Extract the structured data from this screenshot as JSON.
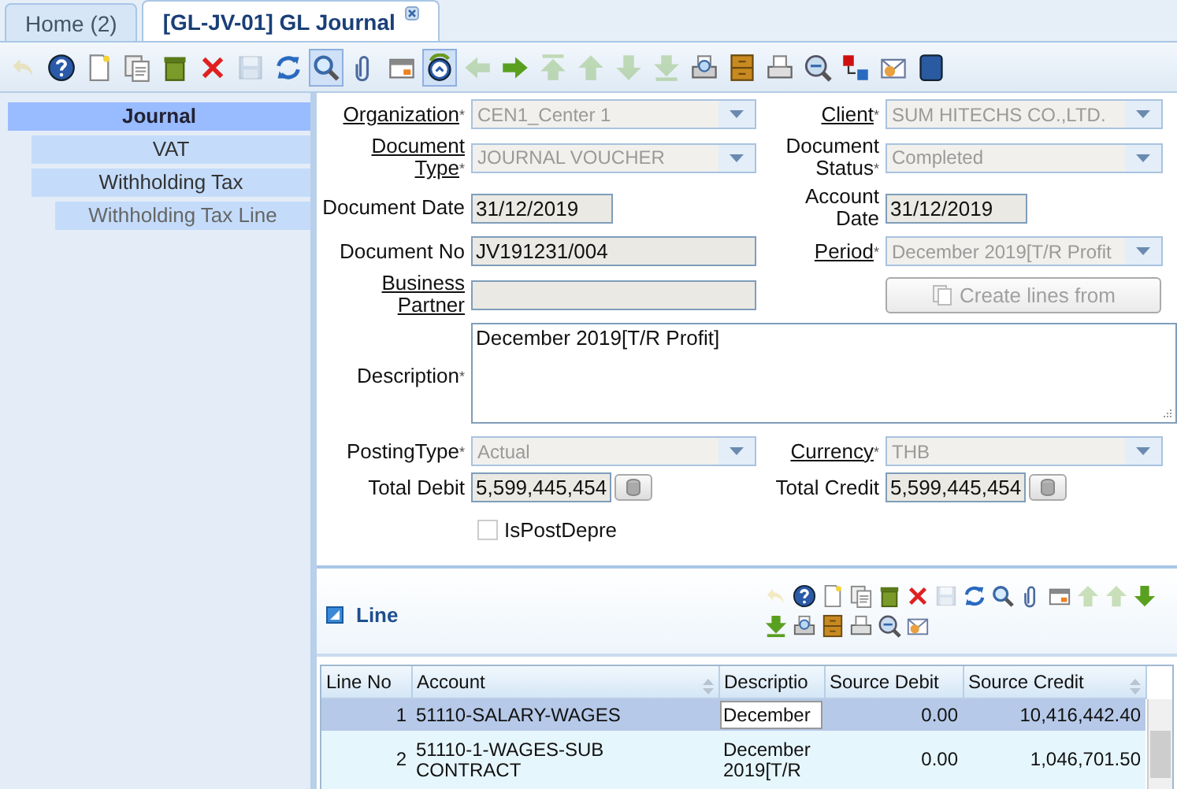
{
  "tabs": [
    {
      "label": "Home (2)",
      "selected": false,
      "closable": false
    },
    {
      "label": "[GL-JV-01] GL Journal",
      "selected": true,
      "closable": true
    }
  ],
  "toolbar": [
    {
      "kind": "undo",
      "disabled": true,
      "pressed": false
    },
    {
      "kind": "help",
      "disabled": false,
      "pressed": false
    },
    {
      "kind": "new",
      "disabled": false,
      "pressed": false
    },
    {
      "kind": "copy",
      "disabled": false,
      "pressed": false
    },
    {
      "kind": "delete",
      "disabled": false,
      "pressed": false
    },
    {
      "kind": "delete_selection",
      "disabled": false,
      "pressed": false
    },
    {
      "kind": "save",
      "disabled": true,
      "pressed": false
    },
    {
      "kind": "refresh",
      "disabled": false,
      "pressed": false
    },
    {
      "kind": "find",
      "disabled": false,
      "pressed": true
    },
    {
      "kind": "attach",
      "disabled": false,
      "pressed": false
    },
    {
      "kind": "grid",
      "disabled": false,
      "pressed": false
    },
    {
      "kind": "history",
      "disabled": false,
      "pressed": true
    },
    {
      "kind": "prev",
      "disabled": true,
      "pressed": false
    },
    {
      "kind": "next",
      "disabled": false,
      "pressed": false
    },
    {
      "kind": "first",
      "disabled": true,
      "pressed": false
    },
    {
      "kind": "up",
      "disabled": true,
      "pressed": false
    },
    {
      "kind": "down",
      "disabled": true,
      "pressed": false
    },
    {
      "kind": "last",
      "disabled": true,
      "pressed": false
    },
    {
      "kind": "print_preview",
      "disabled": false,
      "pressed": false
    },
    {
      "kind": "archive",
      "disabled": false,
      "pressed": false
    },
    {
      "kind": "print",
      "disabled": false,
      "pressed": false
    },
    {
      "kind": "zoom_across",
      "disabled": false,
      "pressed": false
    },
    {
      "kind": "workflow",
      "disabled": false,
      "pressed": false
    },
    {
      "kind": "request",
      "disabled": false,
      "pressed": false
    },
    {
      "kind": "end",
      "disabled": false,
      "pressed": false
    }
  ],
  "sidebar": {
    "items": [
      {
        "label": "Journal",
        "selected": true,
        "disabled": false,
        "children": [
          {
            "label": "VAT",
            "selected": false,
            "disabled": false
          },
          {
            "label": "Withholding Tax",
            "selected": false,
            "disabled": false,
            "children": [
              {
                "label": "Withholding Tax Line",
                "selected": false,
                "disabled": true
              }
            ]
          }
        ]
      }
    ]
  },
  "form": {
    "rows": [
      [
        {
          "label": "Organization",
          "mark": "*",
          "link": true,
          "kind": "select",
          "value": "CEN1_Center 1",
          "disabled": true
        },
        {
          "label": "Client",
          "mark": "*",
          "link": true,
          "kind": "select",
          "value": "SUM HITECHS CO.,LTD.",
          "disabled": true
        }
      ],
      [
        {
          "label": "Document Type",
          "mark": "*",
          "link": true,
          "kind": "select",
          "value": "JOURNAL VOUCHER",
          "disabled": true
        },
        {
          "label": "Document Status",
          "mark": "*",
          "link": false,
          "kind": "select",
          "value": "Completed",
          "disabled": true
        }
      ],
      [
        {
          "label": "Document Date",
          "link": false,
          "kind": "date",
          "value": "31/12/2019",
          "disabled": false
        },
        {
          "label": "Account Date",
          "link": false,
          "kind": "date",
          "value": "31/12/2019",
          "disabled": false
        }
      ],
      [
        {
          "label": "Document No",
          "link": false,
          "kind": "text",
          "value": "JV191231/004",
          "disabled": false
        },
        {
          "label": "Period",
          "mark": "*",
          "link": true,
          "kind": "select",
          "value": "December 2019[T/R Profit",
          "disabled": true
        }
      ],
      [
        {
          "label": "Business Partner",
          "link": true,
          "kind": "text",
          "disabled": false
        },
        {
          "kind": "button",
          "value": "Create lines from",
          "disabled": true
        }
      ],
      [
        {
          "label": "Description",
          "mark": "*",
          "link": false,
          "kind": "textarea",
          "value": "December 2019[T/R Profit]"
        }
      ],
      [
        {
          "label": "PostingType",
          "mark": "*",
          "link": false,
          "kind": "select",
          "value": "Actual",
          "disabled": true
        },
        {
          "label": "Currency",
          "mark": "*",
          "link": true,
          "kind": "select",
          "value": "THB",
          "disabled": true
        }
      ],
      [
        {
          "label": "Total Debit",
          "link": false,
          "kind": "number",
          "value": "5,599,445,454",
          "disabled": false
        },
        {
          "label": "Total Credit",
          "link": false,
          "kind": "number",
          "value": "5,599,445,454",
          "disabled": false
        }
      ],
      [
        {
          "kind": "checkbox",
          "value": "IsPostDepre",
          "checked": false,
          "disabled": true
        }
      ]
    ]
  },
  "line": {
    "title": "Line",
    "expanded": true,
    "toolbar": [
      {
        "kind": "undo",
        "disabled": true
      },
      {
        "kind": "help",
        "disabled": false
      },
      {
        "kind": "new",
        "disabled": false
      },
      {
        "kind": "copy",
        "disabled": false
      },
      {
        "kind": "delete",
        "disabled": false
      },
      {
        "kind": "delete_selection",
        "disabled": false
      },
      {
        "kind": "save",
        "disabled": true
      },
      {
        "kind": "refresh",
        "disabled": false
      },
      {
        "kind": "find",
        "disabled": false
      },
      {
        "kind": "attach",
        "disabled": false
      },
      {
        "kind": "grid",
        "disabled": false
      },
      {
        "kind": "up",
        "disabled": true
      },
      {
        "kind": "up",
        "disabled": true
      },
      {
        "kind": "down",
        "disabled": false
      },
      {
        "kind": "last",
        "disabled": false
      },
      {
        "kind": "print_preview",
        "disabled": false
      },
      {
        "kind": "archive",
        "disabled": false
      },
      {
        "kind": "print",
        "disabled": false
      },
      {
        "kind": "zoom_across",
        "disabled": false
      },
      {
        "kind": "request",
        "disabled": false
      }
    ],
    "table": {
      "columns": [
        {
          "label": "Line No",
          "sortable": false
        },
        {
          "label": "Account",
          "sortable": true
        },
        {
          "label": "Descriptio",
          "sortable": false
        },
        {
          "label": "Source Debit",
          "sortable": false
        },
        {
          "label": "Source Credit",
          "sortable": true
        }
      ],
      "rows": [
        {
          "selected": true,
          "editing": true,
          "line_no": "1",
          "account": "51110-SALARY-WAGES",
          "description": "December",
          "source_debit": "0.00",
          "source_credit": "10,416,442.40"
        },
        {
          "selected": false,
          "editing": false,
          "line_no": "2",
          "account": "51110-1-WAGES-SUB CONTRACT",
          "description": "December 2019[T/R",
          "source_debit": "0.00",
          "source_credit": "1,046,701.50"
        }
      ]
    }
  }
}
